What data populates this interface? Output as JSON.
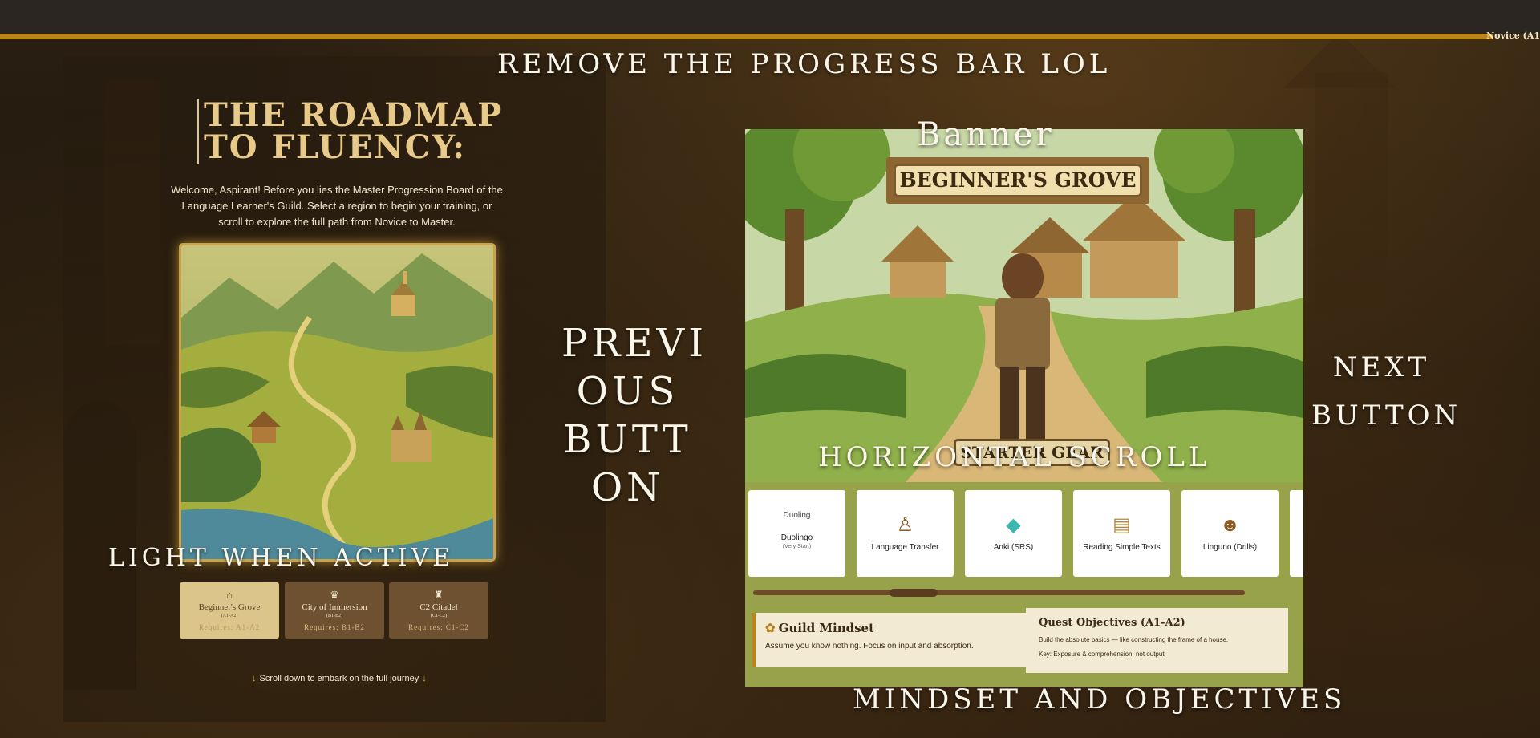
{
  "top_bar": {
    "progress_percent": 97,
    "progress_label": "Novice (A1"
  },
  "annotations": {
    "remove_progress": "REMOVE THE PROGRESS BAR LOL",
    "banner": "Banner",
    "previous_button": "PREVI OUS BUTT ON",
    "next_button": "NEXT BUTTON",
    "horizontal_scroll": "HORIZONTAL SCROLL",
    "light_when_active": "LIGHT WHEN ACTIVE",
    "mindset_objectives": "MINDSET AND OBJECTIVES"
  },
  "hero": {
    "title_line1": "THE ROADMAP",
    "title_line2": "TO FLUENCY:",
    "intro": "Welcome, Aspirant! Before you lies the Master Progression Board of the Language Learner's Guild. Select a region to begin your training, or scroll to explore the full path from Novice to Master."
  },
  "regions": [
    {
      "icon": "hut-icon",
      "name": "Beginner's Grove",
      "level": "(A1-A2)",
      "requires": "Requires: A1-A2",
      "active": true
    },
    {
      "icon": "city-icon",
      "name": "City of Immersion",
      "level": "(B1-B2)",
      "requires": "Requires: B1-B2",
      "active": false
    },
    {
      "icon": "citadel-icon",
      "name": "C2 Citadel",
      "level": "(C1-C2)",
      "requires": "Requires: C1-C2",
      "active": false
    }
  ],
  "scroll_hint": "Scroll down to embark on the full journey",
  "region_detail": {
    "banner": "BEGINNER'S GROVE",
    "starter_gear": "STARTER GEAR",
    "tools": [
      {
        "name": "Duolingo",
        "sub": "(Very Start)",
        "alt": "Duoling",
        "icon": "broken-image-icon"
      },
      {
        "name": "Language Transfer",
        "sub": "",
        "icon": "owl-icon"
      },
      {
        "name": "Anki (SRS)",
        "sub": "",
        "icon": "crystal-icon"
      },
      {
        "name": "Reading Simple Texts",
        "sub": "",
        "icon": "scroll-icon"
      },
      {
        "name": "Linguno (Drills)",
        "sub": "",
        "icon": "monkey-icon"
      }
    ],
    "mindset": {
      "title": "Guild Mindset",
      "text": "Assume you know nothing. Focus on input and absorption."
    },
    "objectives": {
      "title": "Quest Objectives (A1-A2)",
      "line1": "Build the absolute basics — like constructing the frame of a house.",
      "line2": "Key: Exposure & comprehension, not output."
    }
  },
  "colors": {
    "accent_gold": "#b88718",
    "panel_green": "#97a24a",
    "card_active": "#dcc58a",
    "card_inactive": "#6e5130"
  }
}
